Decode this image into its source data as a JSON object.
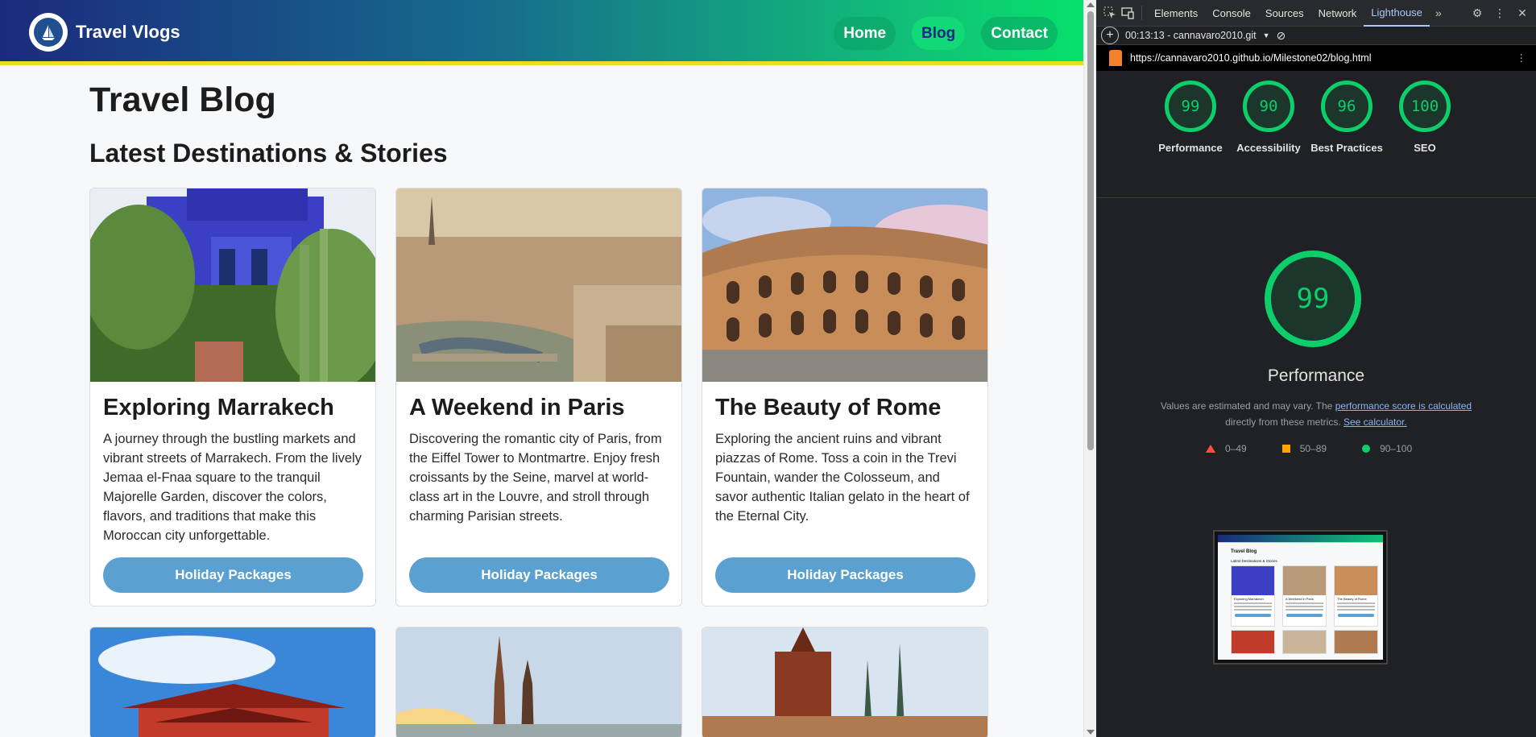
{
  "site": {
    "brand": "Travel Vlogs",
    "nav": [
      "Home",
      "Blog",
      "Contact"
    ],
    "active_nav": "Blog",
    "page_title": "Travel Blog",
    "section_title": "Latest Destinations & Stories",
    "cards": [
      {
        "title": "Exploring Marrakech",
        "text": "A journey through the bustling markets and vibrant streets of Marrakech. From the lively Jemaa el-Fnaa square to the tranquil Majorelle Garden, discover the colors, flavors, and traditions that make this Moroccan city unforgettable.",
        "button": "Holiday Packages"
      },
      {
        "title": "A Weekend in Paris",
        "text": "Discovering the romantic city of Paris, from the Eiffel Tower to Montmartre. Enjoy fresh croissants by the Seine, marvel at world-class art in the Louvre, and stroll through charming Parisian streets.",
        "button": "Holiday Packages"
      },
      {
        "title": "The Beauty of Rome",
        "text": "Exploring the ancient ruins and vibrant piazzas of Rome. Toss a coin in the Trevi Fountain, wander the Colosseum, and savor authentic Italian gelato in the heart of the Eternal City.",
        "button": "Holiday Packages"
      }
    ]
  },
  "devtools": {
    "tabs": [
      "Elements",
      "Console",
      "Sources",
      "Network",
      "Lighthouse"
    ],
    "active_tab": "Lighthouse",
    "report_label": "00:13:13 - cannavaro2010.git",
    "url": "https://cannavaro2010.github.io/Milestone02/blog.html",
    "scores": [
      {
        "value": "99",
        "label": "Performance"
      },
      {
        "value": "90",
        "label": "Accessibility"
      },
      {
        "value": "96",
        "label": "Best Practices"
      },
      {
        "value": "100",
        "label": "SEO"
      }
    ],
    "main_score": "99",
    "main_label": "Performance",
    "note_prefix": "Values are estimated and may vary. The",
    "note_link1": "performance score is calculated",
    "note_middle": "directly from these metrics.",
    "note_link2": "See calculator.",
    "legend": [
      "0–49",
      "50–89",
      "90–100"
    ],
    "colors": {
      "pass": "#0cce6b",
      "average": "#ffa400",
      "fail": "#ff4e42"
    },
    "screenshot": {
      "title": "Travel Blog",
      "subtitle": "Latest Destinations & Stories",
      "card_titles": [
        "Exploring Marrakech",
        "A Weekend in Paris",
        "The Beauty of Rome"
      ]
    }
  }
}
